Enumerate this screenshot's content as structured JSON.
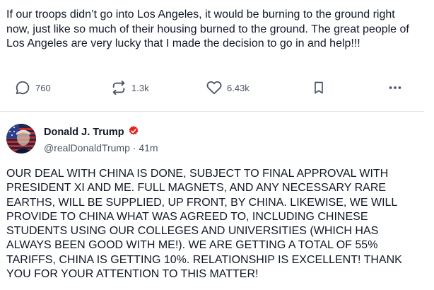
{
  "previous_post": {
    "text": "If our troops didn’t go into Los Angeles, it would be burning to the ground right now, just like so much of their housing burned to the ground. The great people of Los Angeles are very lucky that I made the decision to go in and help!!!",
    "actions": {
      "reply_icon": "reply-bubble-icon",
      "reply_count": "760",
      "retruth_icon": "retruth-arrows-icon",
      "retruth_count": "1.3k",
      "like_icon": "heart-icon",
      "like_count": "6.43k",
      "bookmark_icon": "bookmark-icon",
      "more_icon": "more-dots-icon"
    }
  },
  "current_post": {
    "display_name": "Donald J. Trump",
    "verified_icon": "verified-badge-icon",
    "verified_color": "#e1251b",
    "handle": "@realDonaldTrump",
    "separator": " · ",
    "time": "41m",
    "text": "OUR DEAL WITH CHINA IS DONE, SUBJECT TO FINAL APPROVAL WITH PRESIDENT XI AND ME. FULL MAGNETS, AND ANY NECESSARY RARE EARTHS, WILL BE SUPPLIED, UP FRONT, BY CHINA. LIKEWISE, WE WILL PROVIDE TO CHINA WHAT WAS AGREED TO, INCLUDING CHINESE STUDENTS USING OUR COLLEGES AND UNIVERSITIES (WHICH HAS ALWAYS BEEN GOOD WITH ME!). WE ARE GETTING A TOTAL OF 55% TARIFFS, CHINA IS GETTING 10%. RELATIONSHIP IS EXCELLENT! THANK YOU FOR YOUR ATTENTION TO THIS MATTER!"
  },
  "colors": {
    "text": "#111827",
    "muted": "#4b5563",
    "divider": "#e5e7eb"
  }
}
